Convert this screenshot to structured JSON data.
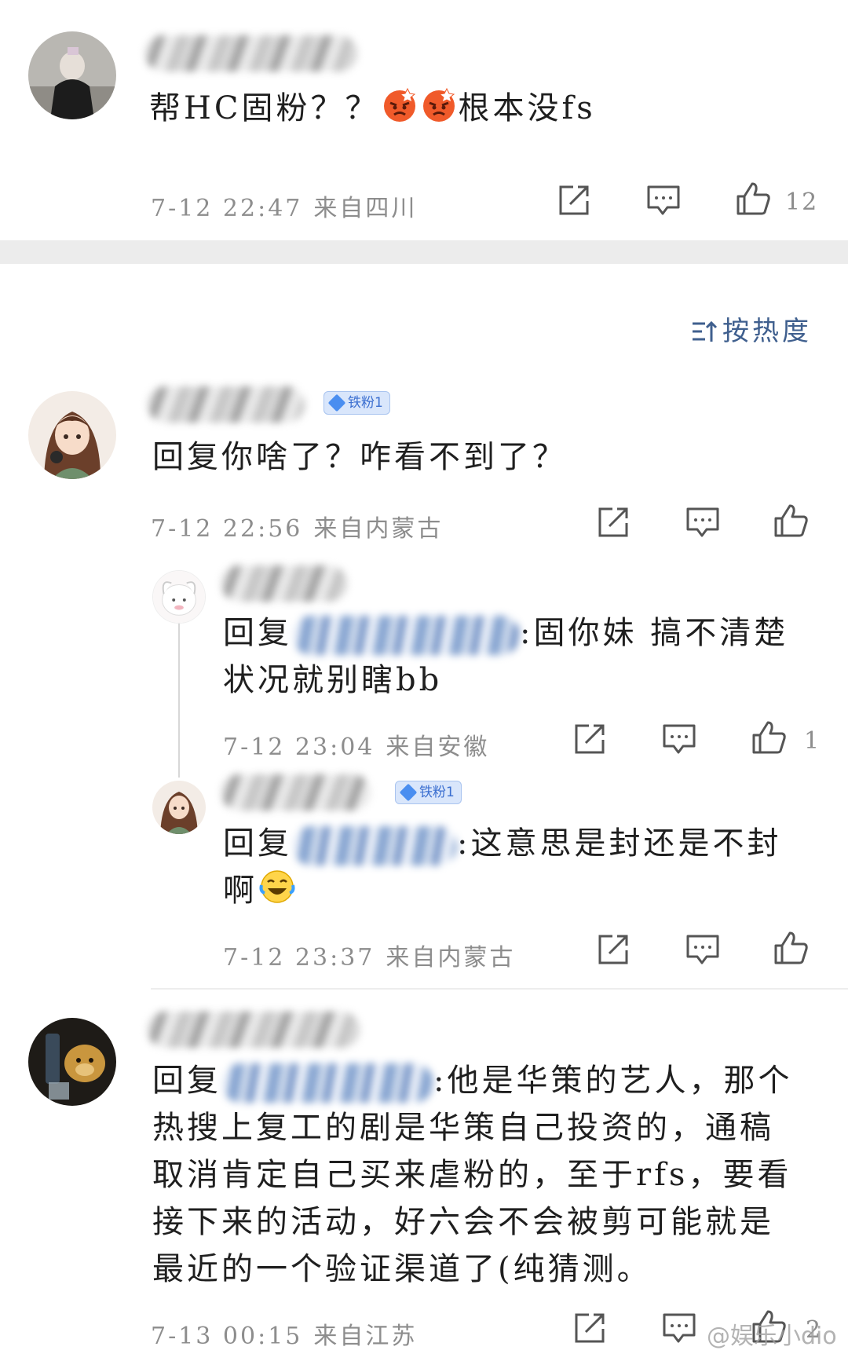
{
  "comments": [
    {
      "text_parts": [
        "帮HC固粉？？",
        "根本没fs"
      ],
      "emojis": [
        "angry-face-icon",
        "angry-face-icon"
      ],
      "time": "7-12 22:47",
      "location": "来自四川",
      "likes": "12"
    },
    {
      "badge": "铁粉1",
      "text": "回复你啥了？咋看不到了？",
      "time": "7-12 22:56",
      "location": "来自内蒙古",
      "likes": ""
    },
    {
      "reply_prefix": "回复",
      "text_line1": ":固你妹 搞不清楚",
      "text_line2": "状况就别瞎bb",
      "time": "7-12 23:04",
      "location": "来自安徽",
      "likes": "1"
    },
    {
      "badge": "铁粉1",
      "reply_prefix": "回复",
      "text_line1": ":这意思是封还是不封",
      "text_line2": "啊",
      "emoji": "crying-laughing-face-icon",
      "time": "7-12 23:37",
      "location": "来自内蒙古",
      "likes": ""
    },
    {
      "reply_prefix": "回复",
      "text_line1": ":他是华策的艺人，那个",
      "text_line2": "热搜上复工的剧是华策自己投资的，通稿",
      "text_line3": "取消肯定自己买来虐粉的，至于rfs，要看",
      "text_line4": "接下来的活动，好六会不会被剪可能就是",
      "text_line5": "最近的一个验证渠道了(纯猜测。",
      "time": "7-13 00:15",
      "location": "来自江苏",
      "likes": "2"
    }
  ],
  "sort": {
    "label": "按热度",
    "icon": "sort-icon"
  },
  "watermark": "@娱乐小dio",
  "colors": {
    "link_blue": "#3f5f8e",
    "meta_gray": "#8d8d8d",
    "badge_blue": "#3b6fd0",
    "divider": "#ececec"
  }
}
